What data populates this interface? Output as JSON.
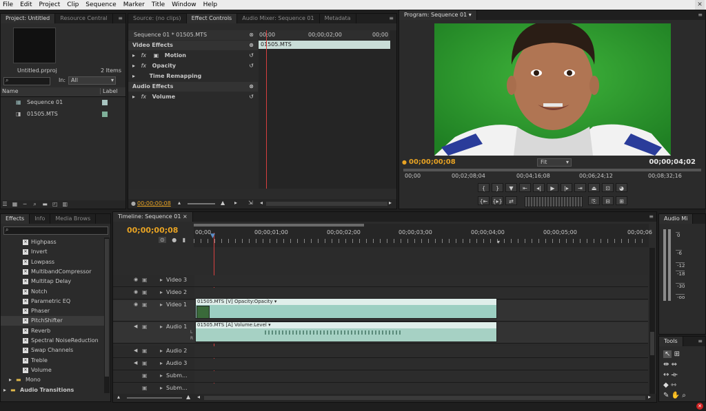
{
  "menu": [
    "File",
    "Edit",
    "Project",
    "Clip",
    "Sequence",
    "Marker",
    "Title",
    "Window",
    "Help"
  ],
  "project": {
    "tabs": [
      "Project: Untitled",
      "Resource Central"
    ],
    "file": "Untitled.prproj",
    "count": "2 Items",
    "in_label": "In:",
    "in_value": "All",
    "col_name": "Name",
    "col_label": "Label",
    "items": [
      "Sequence 01",
      "01505.MTS"
    ]
  },
  "source": {
    "tabs": [
      "Source: (no clips)",
      "Effect Controls",
      "Audio Mixer: Sequence 01",
      "Metadata"
    ],
    "header_clip": "Sequence 01 * 01505.MTS",
    "ruler": [
      "00;00",
      "00;00;02;00",
      "00;00"
    ],
    "clip_bar": "01505.MTS",
    "video_effects": "Video Effects",
    "motion": "Motion",
    "opacity": "Opacity",
    "time_remap": "Time Remapping",
    "audio_effects": "Audio Effects",
    "volume": "Volume",
    "timecode": "00;00;00;08"
  },
  "program": {
    "tab": "Program: Sequence 01",
    "timecode": "00;00;00;08",
    "fit": "Fit",
    "duration": "00;00;04;02",
    "ruler": [
      "00;00",
      "00;02;08;04",
      "00;04;16;08",
      "00;06;24;12",
      "00;08;32;16"
    ]
  },
  "effects": {
    "tabs": [
      "Effects",
      "Info",
      "Media Brows"
    ],
    "items": [
      "Highpass",
      "Invert",
      "Lowpass",
      "MultibandCompressor",
      "Multitap Delay",
      "Notch",
      "Parametric EQ",
      "Phaser",
      "PitchShifter",
      "Reverb",
      "Spectral NoiseReduction",
      "Swap Channels",
      "Treble",
      "Volume"
    ],
    "folder_mono": "Mono",
    "folder_audio_trans": "Audio Transitions",
    "selected": "PitchShifter"
  },
  "timeline": {
    "tab": "Timeline: Sequence 01",
    "timecode": "00;00;00;08",
    "ruler": [
      "00;00",
      "00;00;01;00",
      "00;00;02;00",
      "00;00;03;00",
      "00;00;04;00",
      "00;00;05;00",
      "00;00;06"
    ],
    "tracks": [
      "Video 3",
      "Video 2",
      "Video 1",
      "Audio 1",
      "Audio 2",
      "Audio 3",
      "Subm...",
      "Subm..."
    ],
    "video_clip": "01505.MTS [V]  Opacity:Opacity",
    "audio_clip": "01505.MTS [A]  Volume:Level",
    "audio_clip_l": "L",
    "audio_clip_r": "R"
  },
  "audio_meter": {
    "tab": "Audio Mi",
    "labels": [
      "0",
      "-6",
      "-12",
      "-18",
      "-30",
      "-oo"
    ]
  },
  "tools": {
    "tab": "Tools"
  },
  "colors": {
    "accent": "#e8a323",
    "playhead": "#d94040",
    "clip_video": "#9ccfc2",
    "clip_audio": "#a6d1c4",
    "greenscreen": "#2f9f2f"
  }
}
